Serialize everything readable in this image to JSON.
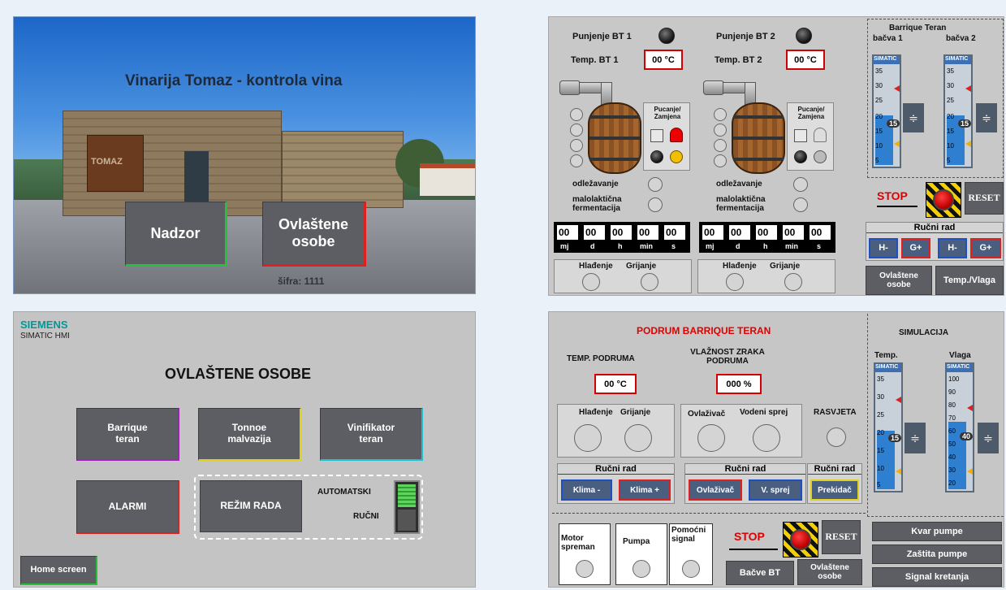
{
  "q1": {
    "title": "Vinarija Tomaz - kontrola vina",
    "building_sign": "TOMAZ",
    "btn_nadzor": "Nadzor",
    "btn_ovlastene": "Ovlaštene osobe",
    "password_hint": "šifra: 1111"
  },
  "q2": {
    "brand": "SIEMENS",
    "brand_sub": "SIMATIC HMI",
    "title": "OVLAŠTENE OSOBE",
    "btn_barrique": "Barrique teran",
    "btn_tonnoe": "Tonnoe malvazija",
    "btn_vinifikator": "Vinifikator teran",
    "btn_alarmi": "ALARMI",
    "btn_rezim": "REŽIM RADA",
    "mode_auto": "AUTOMATSKI",
    "mode_manual": "RUČNI",
    "btn_home": "Home screen"
  },
  "q3": {
    "punjenje1": "Punjenje BT 1",
    "punjenje2": "Punjenje BT 2",
    "temp1": "Temp. BT 1",
    "temp2": "Temp. BT 2",
    "temp1_val": "00 °C",
    "temp2_val": "00 °C",
    "pucanje": "Pucanje/ Zamjena",
    "odlezavanje": "odležavanje",
    "malolakticna": "malolaktična fermentacija",
    "timer_vals": [
      "00",
      "00",
      "00",
      "00",
      "00"
    ],
    "timer_units": [
      "mj",
      "d",
      "h",
      "min",
      "s"
    ],
    "hladenje": "Hlađenje",
    "grijanje": "Grijanje",
    "gauge_group_title": "Barrique Teran",
    "gauge1_label": "bačva 1",
    "gauge2_label": "bačva 2",
    "simatic": "SIMATIC",
    "gauge_ticks": [
      "35",
      "30",
      "25",
      "20",
      "15",
      "10",
      "5"
    ],
    "gauge1_value": "15",
    "gauge2_value": "15",
    "gauge1_level": 0.55,
    "gauge2_level": 0.55,
    "stop": "STOP",
    "reset": "RESET",
    "rucni_rad": "Ručni rad",
    "h_minus": "H-",
    "g_plus": "G+",
    "btn_ovlastene": "Ovlaštene osobe",
    "btn_temp_vlaga": "Temp./Vlaga"
  },
  "q4": {
    "title": "PODRUM BARRIQUE TERAN",
    "temp_podruma": "TEMP. PODRUMA",
    "vlaznost": "VLAŽNOST ZRAKA PODRUMA",
    "temp_val": "00 °C",
    "vlaga_val": "000 %",
    "hladenje": "Hlađenje",
    "grijanje": "Grijanje",
    "ovlazivac": "Ovlaživač",
    "vodeni_sprej": "Vodeni sprej",
    "rasvjeta": "RASVJETA",
    "rucni_rad": "Ručni rad",
    "klima_minus": "Klima -",
    "klima_plus": "Klima +",
    "btn_ovlazivac": "Ovlaživač",
    "btn_vsprej": "V. sprej",
    "btn_prekidac": "Prekidač",
    "motor": "Motor spreman",
    "pumpa": "Pumpa",
    "pomocni": "Pomoćni signal",
    "stop": "STOP",
    "reset": "RESET",
    "btn_bacve": "Bačve BT",
    "btn_ovlastene": "Ovlaštene osobe",
    "simulacija": "SIMULACIJA",
    "temp_label": "Temp.",
    "vlaga_label": "Vlaga",
    "simatic": "SIMATIC",
    "temp_ticks": [
      "35",
      "30",
      "25",
      "20",
      "15",
      "10",
      "5"
    ],
    "vlaga_ticks": [
      "100",
      "90",
      "80",
      "70",
      "60",
      "50",
      "40",
      "30",
      "20"
    ],
    "temp_value": "15",
    "vlaga_value": "40",
    "temp_level": 0.55,
    "vlaga_level": 0.62,
    "kvar_pumpe": "Kvar pumpe",
    "zastita_pumpe": "Zaštita pumpe",
    "signal_kretanja": "Signal kretanja"
  }
}
